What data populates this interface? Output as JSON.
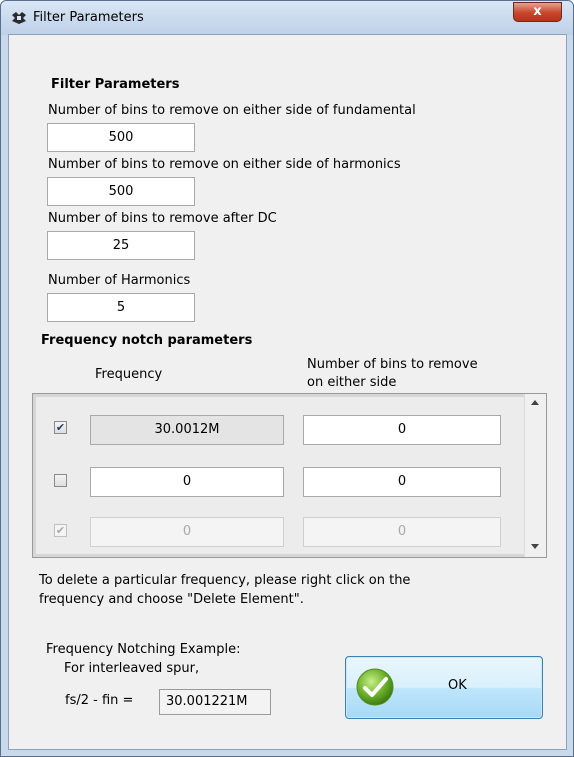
{
  "window": {
    "title": "Filter Parameters",
    "close_glyph": "x"
  },
  "filter": {
    "heading": "Filter Parameters",
    "fundamental_label": "Number of bins to remove on either side of fundamental",
    "fundamental_value": "500",
    "harmonics_label": "Number of bins to remove on either side of harmonics",
    "harmonics_value": "500",
    "after_dc_label": "Number of bins to remove after DC",
    "after_dc_value": "25",
    "num_harmonics_label": "Number of Harmonics",
    "num_harmonics_value": "5"
  },
  "notch": {
    "heading": "Frequency notch parameters",
    "col_frequency": "Frequency",
    "col_bins_line1": "Number of bins to remove",
    "col_bins_line2": "on either side",
    "rows": [
      {
        "checked": true,
        "frequency": "30.0012M",
        "bins": "0",
        "state": "readonly"
      },
      {
        "checked": false,
        "frequency": "0",
        "bins": "0",
        "state": "editable"
      },
      {
        "checked": true,
        "frequency": "0",
        "bins": "0",
        "state": "disabled"
      }
    ]
  },
  "info": {
    "line1": "To delete a particular frequency, please right click on the",
    "line2": "frequency and choose \"Delete Element\"."
  },
  "example": {
    "heading": "Frequency Notching Example:",
    "subheading": "For interleaved spur,",
    "formula_label": "fs/2 - fin =",
    "formula_value": "30.001221M"
  },
  "ok_button": {
    "label": "OK",
    "icon": "check-icon",
    "icon_color": "#6db22b"
  },
  "colors": {
    "title_bar": "#c9d9ec",
    "close_button": "#c8452c",
    "ok_button": "#bee6fd"
  }
}
